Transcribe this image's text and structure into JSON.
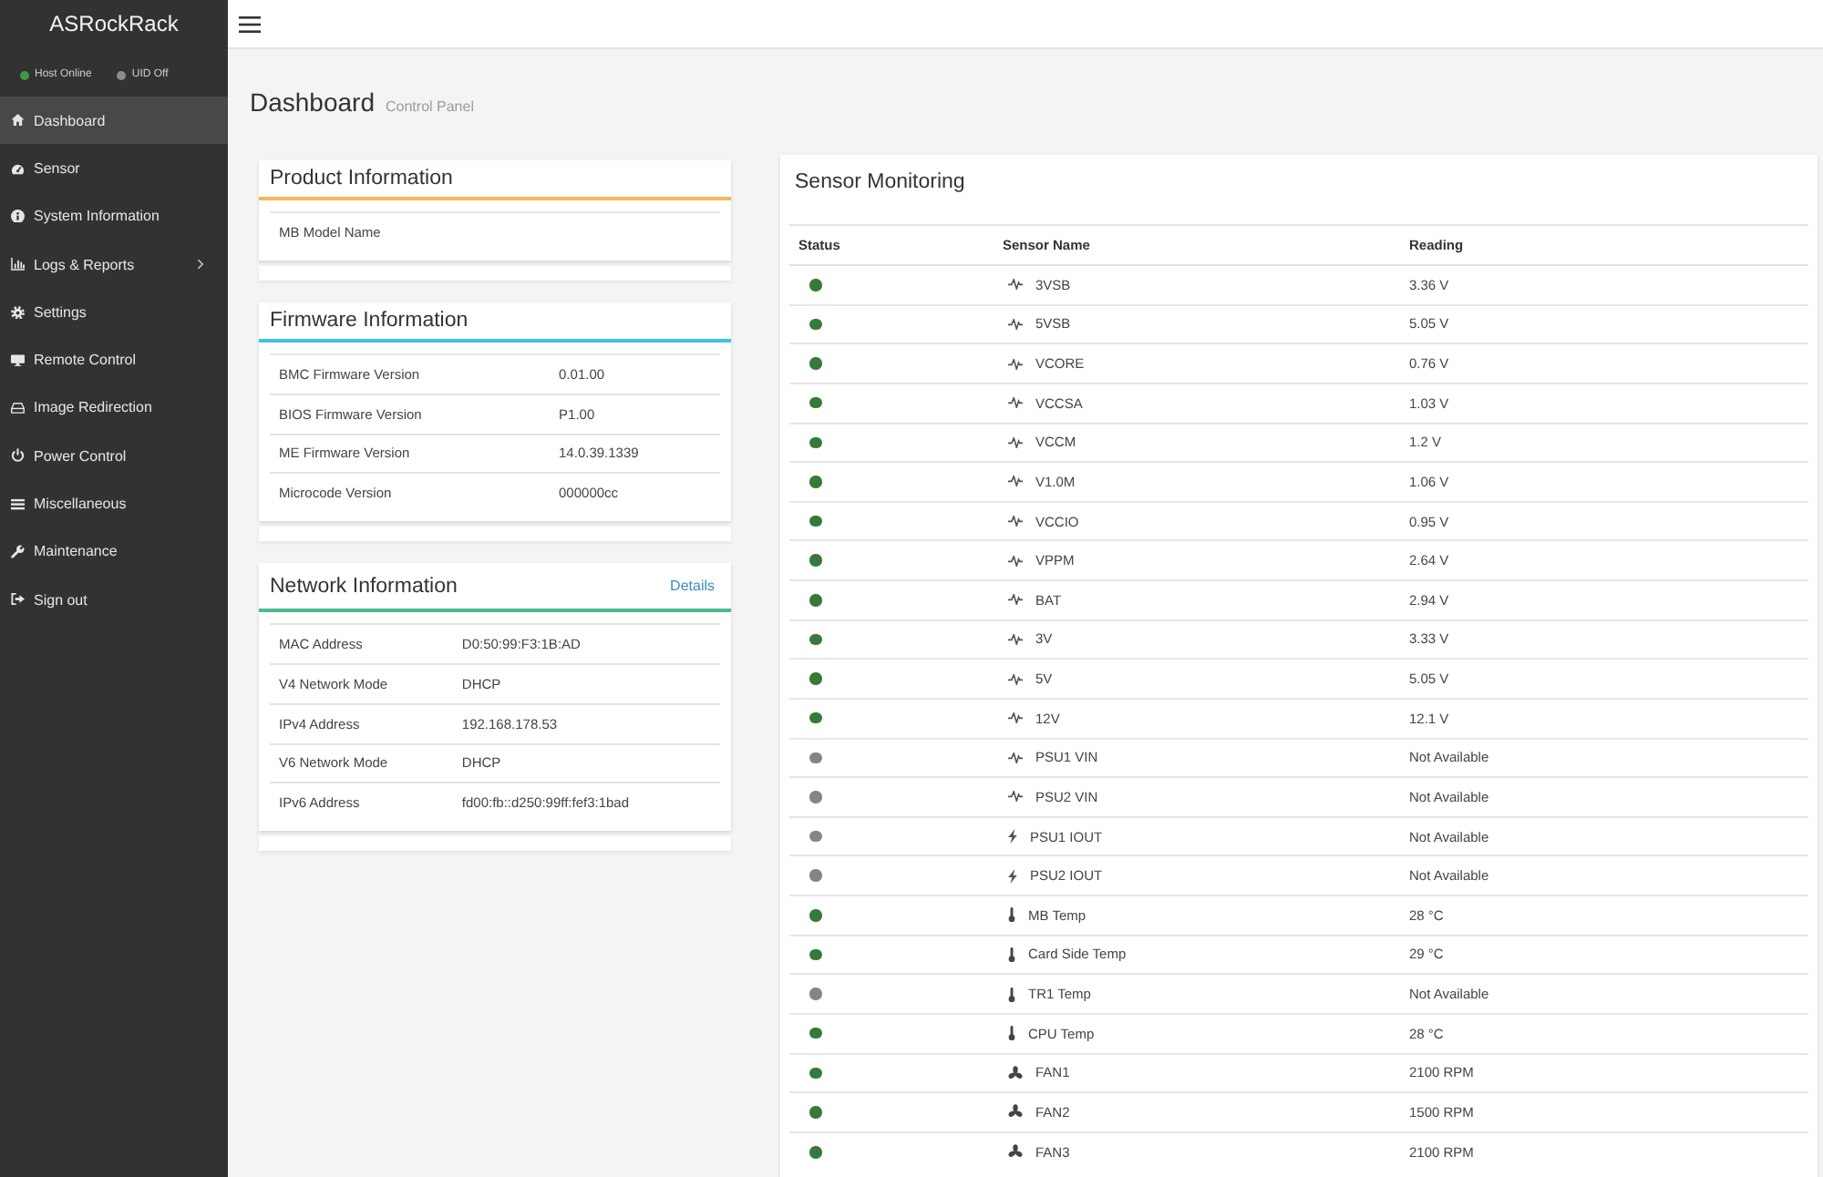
{
  "sidebar": {
    "brand": "ASRockRack",
    "indicators": [
      {
        "label": "Host Online",
        "color": "#3f9b3f"
      },
      {
        "label": "UID Off",
        "color": "#8c8c8c"
      }
    ],
    "items": [
      {
        "label": "Dashboard",
        "selected": true,
        "submenu": false
      },
      {
        "label": "Sensor",
        "selected": false,
        "submenu": false
      },
      {
        "label": "System Information",
        "selected": false,
        "submenu": false
      },
      {
        "label": "Logs & Reports",
        "selected": false,
        "submenu": true
      },
      {
        "label": "Settings",
        "selected": false,
        "submenu": false
      },
      {
        "label": "Remote Control",
        "selected": false,
        "submenu": false
      },
      {
        "label": "Image Redirection",
        "selected": false,
        "submenu": false
      },
      {
        "label": "Power Control",
        "selected": false,
        "submenu": false
      },
      {
        "label": "Miscellaneous",
        "selected": false,
        "submenu": false
      },
      {
        "label": "Maintenance",
        "selected": false,
        "submenu": false
      },
      {
        "label": "Sign out",
        "selected": false,
        "submenu": false
      }
    ]
  },
  "page": {
    "title": "Dashboard",
    "subtitle": "Control Panel"
  },
  "info_cards": [
    {
      "title": "Product Information",
      "color": "#f4b75a",
      "rows": [
        {
          "label": "MB Model Name"
        }
      ]
    },
    {
      "title": "Firmware Information",
      "color": "#3ec2e6",
      "rows": [
        {
          "label": "BMC Firmware Version",
          "value": "0.01.00"
        },
        {
          "label": "BIOS Firmware Version",
          "value": "P1.00"
        },
        {
          "label": "ME Firmware Version",
          "value": "14.0.39.1339"
        },
        {
          "label": "Microcode Version",
          "value": "000000cc"
        }
      ]
    },
    {
      "title": "Network Information",
      "color": "#4dbb8b",
      "link": "Details",
      "rows": [
        {
          "label": "MAC Address",
          "value": "D0:50:99:F3:1B:AD"
        },
        {
          "label": "V4 Network Mode",
          "value": "DHCP"
        },
        {
          "label": "IPv4 Address",
          "value": "192.168.178.53"
        },
        {
          "label": "V6 Network Mode",
          "value": "DHCP"
        },
        {
          "label": "IPv6 Address",
          "value": "fd00:fb::d250:99ff:fef3:1bad"
        }
      ]
    }
  ],
  "sensor_monitoring": {
    "title": "Sensor Monitoring",
    "columns": [
      "Status",
      "Sensor Name",
      "Reading"
    ],
    "rows": [
      {
        "kind": "voltage",
        "color": "#377a37",
        "name": "3VSB",
        "reading": "3.36 V"
      },
      {
        "kind": "voltage",
        "color": "#377a37",
        "name": "5VSB",
        "reading": "5.05 V"
      },
      {
        "kind": "voltage",
        "color": "#377a37",
        "name": "VCORE",
        "reading": "0.76 V"
      },
      {
        "kind": "voltage",
        "color": "#377a37",
        "name": "VCCSA",
        "reading": "1.03 V"
      },
      {
        "kind": "voltage",
        "color": "#377a37",
        "name": "VCCM",
        "reading": "1.2 V"
      },
      {
        "kind": "voltage",
        "color": "#377a37",
        "name": "V1.0M",
        "reading": "1.06 V"
      },
      {
        "kind": "voltage",
        "color": "#377a37",
        "name": "VCCIO",
        "reading": "0.95 V"
      },
      {
        "kind": "voltage",
        "color": "#377a37",
        "name": "VPPM",
        "reading": "2.64 V"
      },
      {
        "kind": "voltage",
        "color": "#377a37",
        "name": "BAT",
        "reading": "2.94 V"
      },
      {
        "kind": "voltage",
        "color": "#377a37",
        "name": "3V",
        "reading": "3.33 V"
      },
      {
        "kind": "voltage",
        "color": "#377a37",
        "name": "5V",
        "reading": "5.05 V"
      },
      {
        "kind": "voltage",
        "color": "#377a37",
        "name": "12V",
        "reading": "12.1 V"
      },
      {
        "kind": "voltage",
        "color": "#858585",
        "name": "PSU1 VIN",
        "reading": "Not Available"
      },
      {
        "kind": "voltage",
        "color": "#858585",
        "name": "PSU2 VIN",
        "reading": "Not Available"
      },
      {
        "kind": "current",
        "color": "#858585",
        "name": "PSU1 IOUT",
        "reading": "Not Available"
      },
      {
        "kind": "current",
        "color": "#858585",
        "name": "PSU2 IOUT",
        "reading": "Not Available"
      },
      {
        "kind": "temperature",
        "color": "#377a37",
        "name": "MB Temp",
        "reading": "28 °C"
      },
      {
        "kind": "temperature",
        "color": "#377a37",
        "name": "Card Side Temp",
        "reading": "29 °C"
      },
      {
        "kind": "temperature",
        "color": "#858585",
        "name": "TR1 Temp",
        "reading": "Not Available"
      },
      {
        "kind": "temperature",
        "color": "#377a37",
        "name": "CPU Temp",
        "reading": "28 °C"
      },
      {
        "kind": "fan",
        "color": "#377a37",
        "name": "FAN1",
        "reading": "2100 RPM"
      },
      {
        "kind": "fan",
        "color": "#377a37",
        "name": "FAN2",
        "reading": "1500 RPM"
      },
      {
        "kind": "fan",
        "color": "#377a37",
        "name": "FAN3",
        "reading": "2100 RPM"
      }
    ]
  }
}
